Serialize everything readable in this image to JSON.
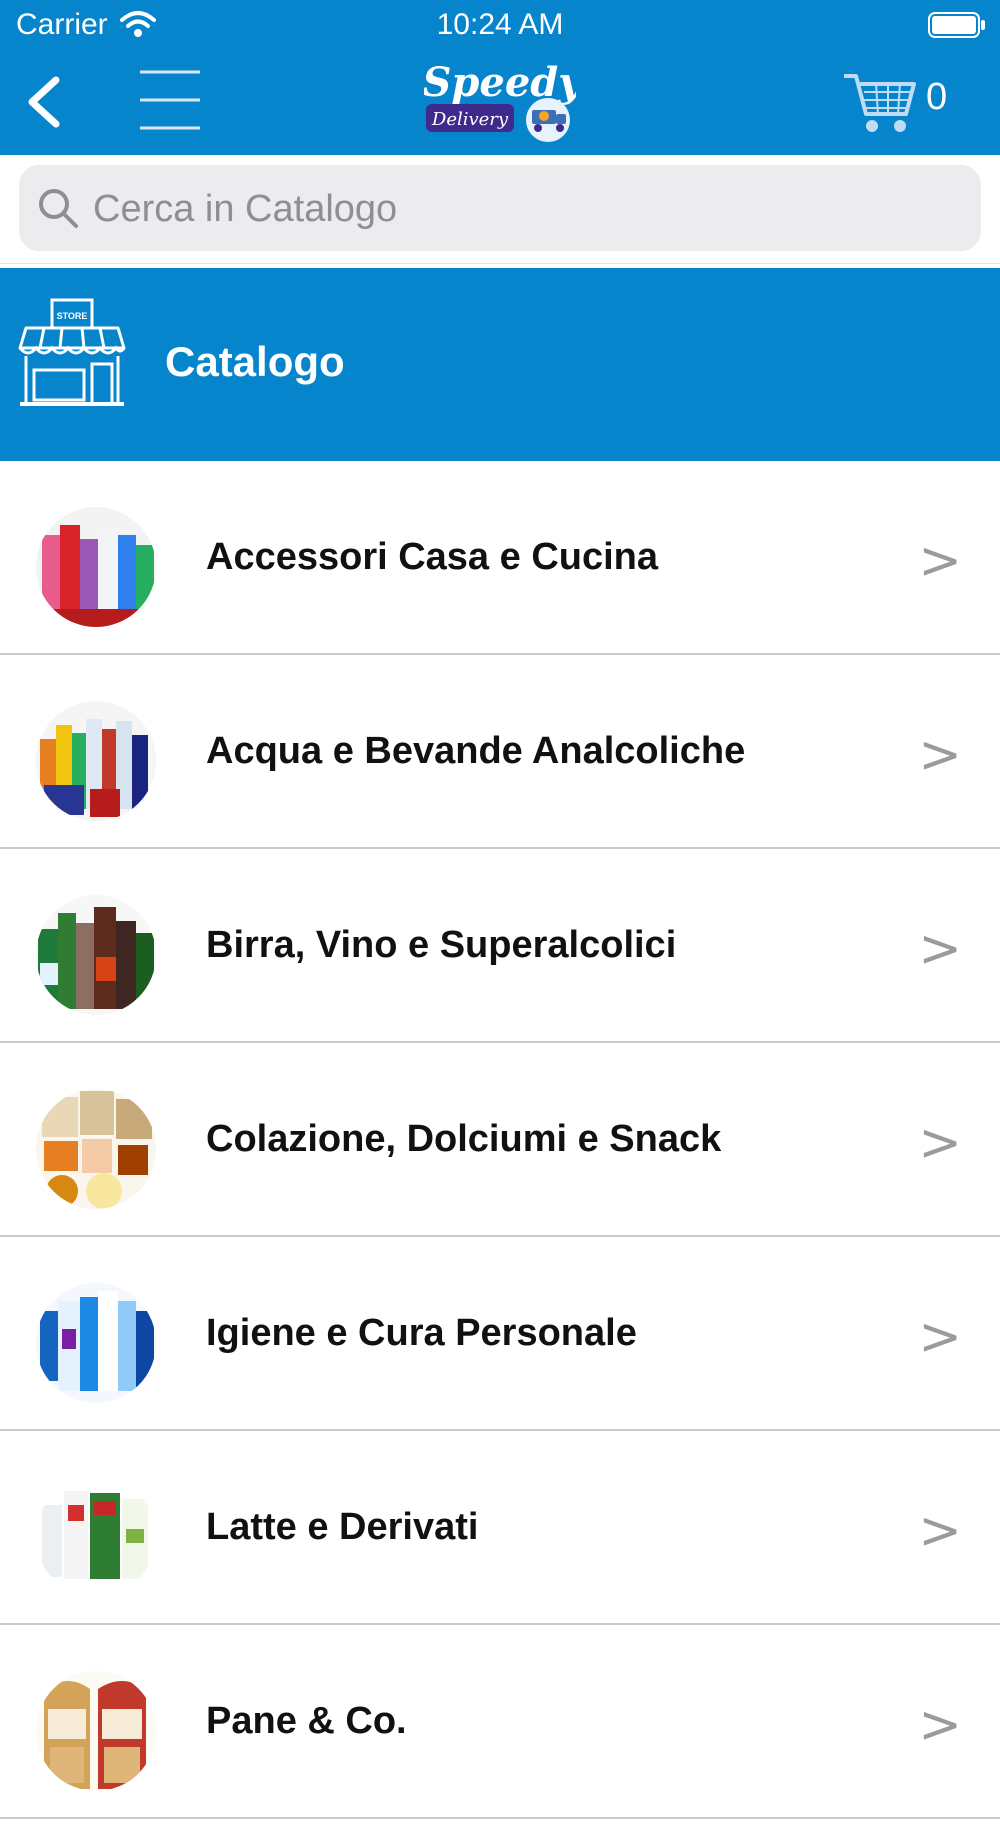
{
  "status": {
    "carrier": "Carrier",
    "time": "10:24 AM"
  },
  "nav": {
    "logo_top": "Speedy",
    "logo_bottom": "Delivery",
    "cart_count": "0"
  },
  "search": {
    "placeholder": "Cerca in Catalogo",
    "value": ""
  },
  "catalog": {
    "title": "Catalogo",
    "store_label": "STORE"
  },
  "colors": {
    "primary": "#0785cc",
    "logo_badge": "#3d2a8c"
  },
  "icons": [
    "chevron-left-icon",
    "hamburger-icon",
    "cart-icon",
    "search-icon",
    "store-icon",
    "chevron-right-icon"
  ],
  "categories": [
    {
      "label": "Accessori Casa e Cucina",
      "chevron": ">"
    },
    {
      "label": "Acqua e Bevande Analcoliche",
      "chevron": ">"
    },
    {
      "label": "Birra, Vino e Superalcolici",
      "chevron": ">"
    },
    {
      "label": "Colazione, Dolciumi e Snack",
      "chevron": ">"
    },
    {
      "label": "Igiene e Cura Personale",
      "chevron": ">"
    },
    {
      "label": "Latte e Derivati",
      "chevron": ">"
    },
    {
      "label": "Pane & Co.",
      "chevron": ">"
    }
  ]
}
